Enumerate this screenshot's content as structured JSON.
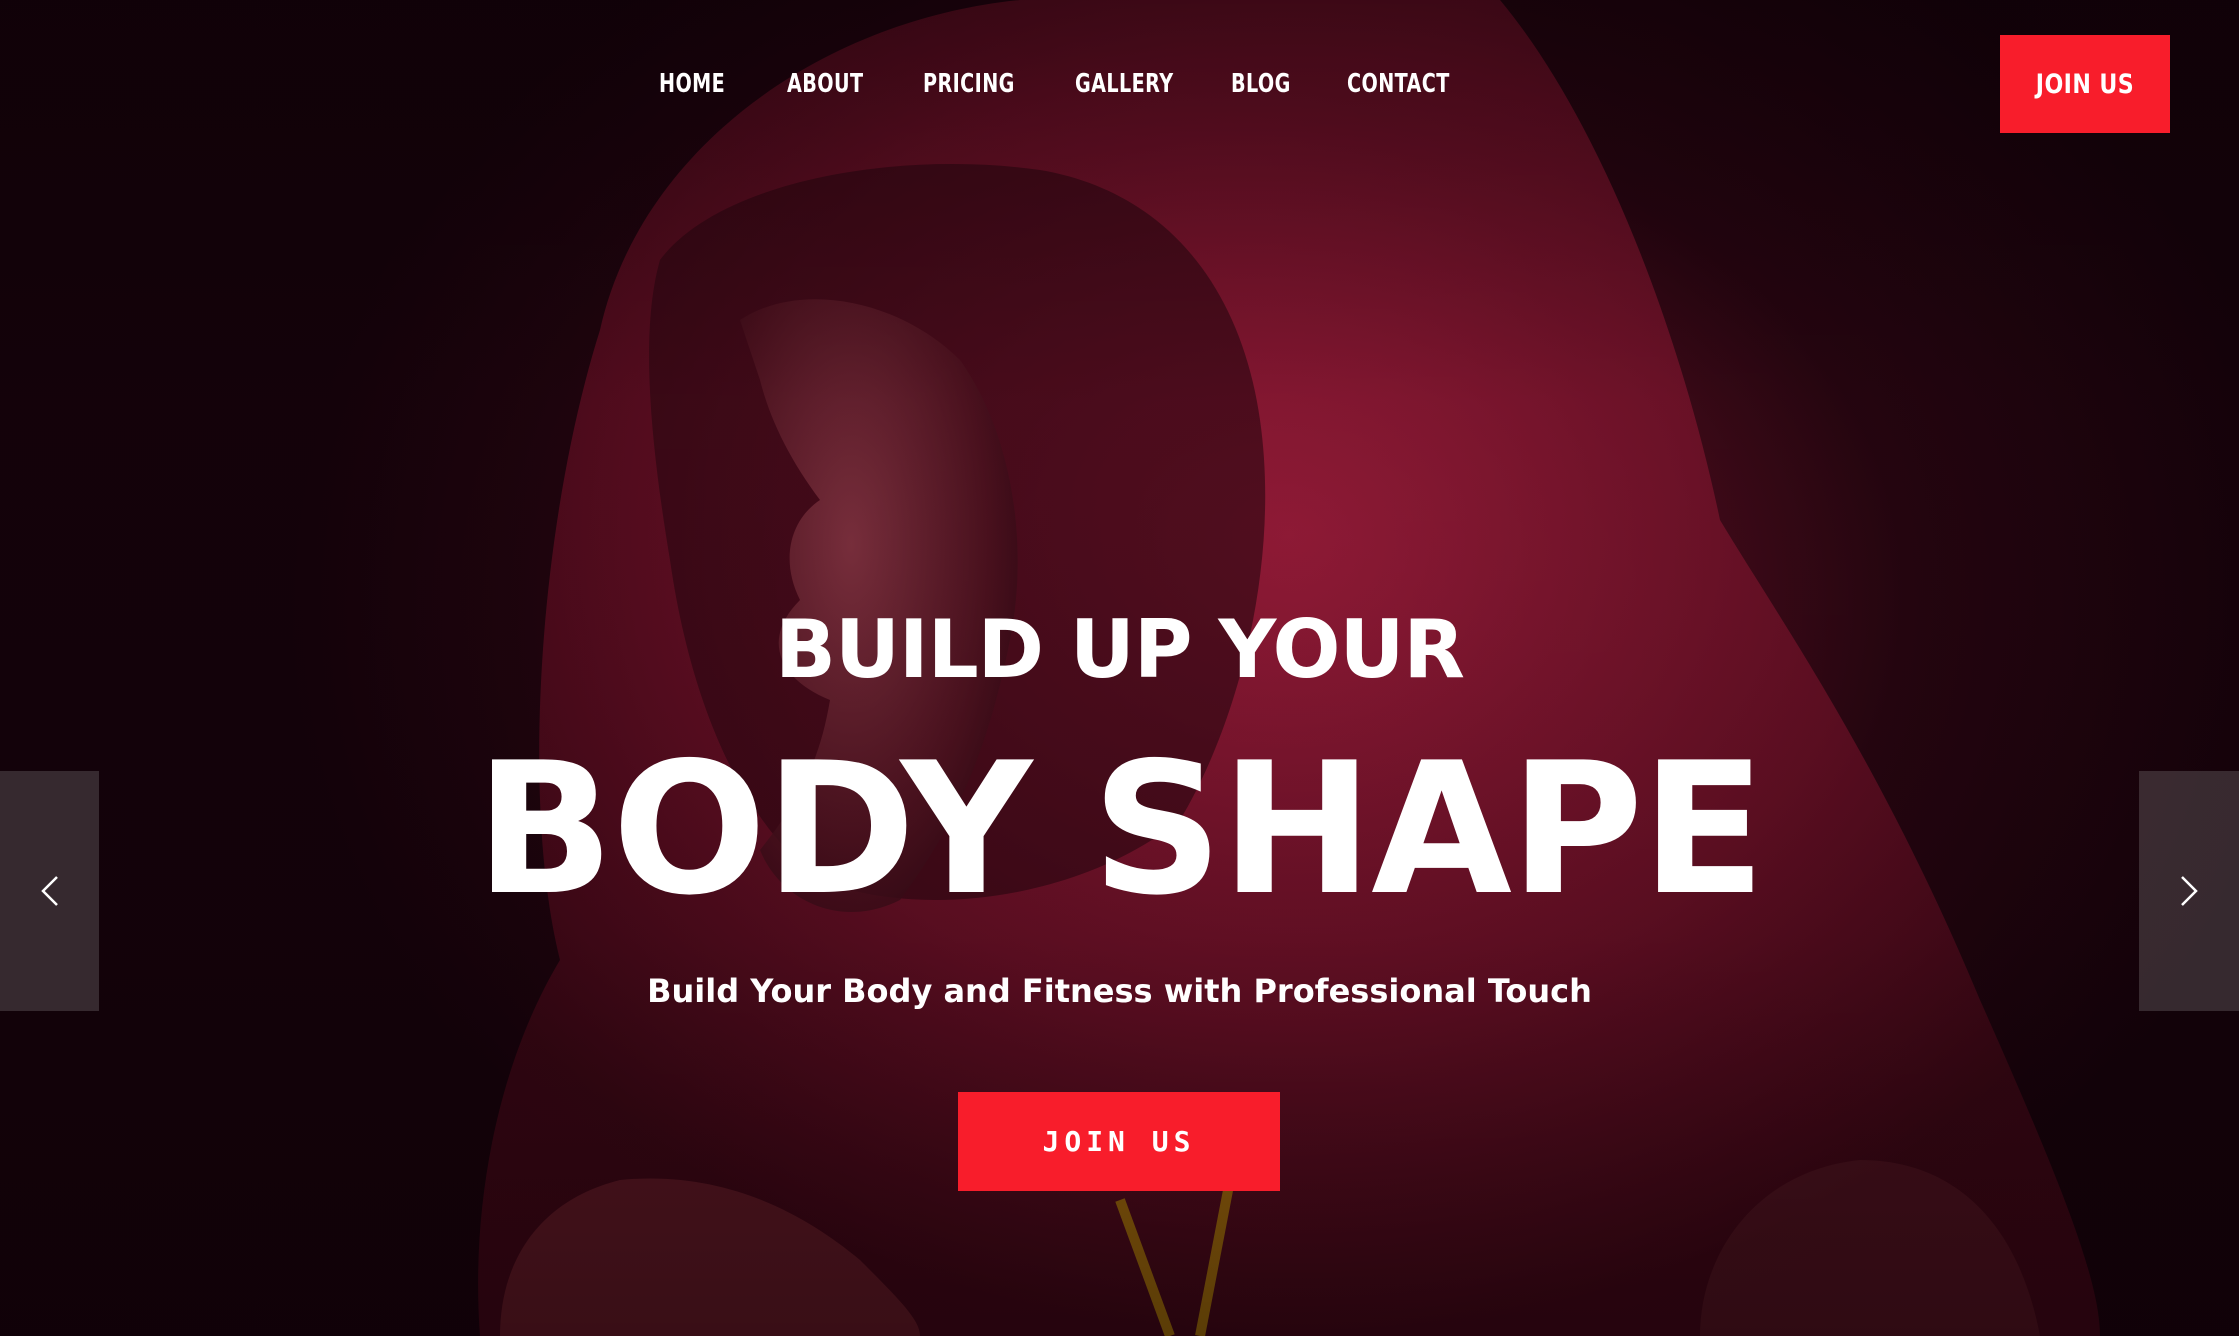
{
  "nav": {
    "items": [
      {
        "label": "HOME"
      },
      {
        "label": "ABOUT"
      },
      {
        "label": "PRICING"
      },
      {
        "label": "GALLERY"
      },
      {
        "label": "BLOG"
      },
      {
        "label": "CONTACT"
      }
    ],
    "join_label": "JOIN US"
  },
  "hero": {
    "headline_line1": "BUILD UP YOUR",
    "headline_line2": "BODY SHAPE",
    "subheadline": "Build Your Body and Fitness with Professional Touch",
    "cta_label": "JOIN US"
  },
  "slider": {
    "prev_icon": "chevron-left-icon",
    "next_icon": "chevron-right-icon"
  },
  "colors": {
    "accent": "#f81d2b",
    "background": "#1a0208",
    "text": "#ffffff"
  }
}
